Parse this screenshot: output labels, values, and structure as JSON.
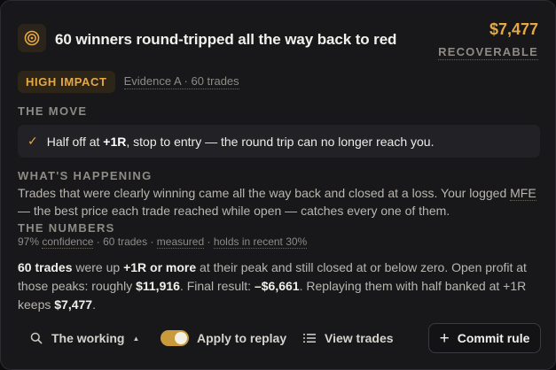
{
  "header": {
    "icon": "target-icon",
    "title": "60 winners round-tripped all the way back to red",
    "amount": "$7,477",
    "amount_label": "RECOVERABLE"
  },
  "tags": {
    "impact": "HIGH IMPACT",
    "evidence": "Evidence A · 60 trades"
  },
  "move": {
    "label": "THE MOVE",
    "prefix": "Half off at ",
    "strong": "+1R",
    "suffix": ", stop to entry — the round trip can no longer reach you."
  },
  "happening": {
    "label": "WHAT'S HAPPENING",
    "text_a": "Trades that were clearly winning came all the way back and closed at a loss. Your logged ",
    "mfe": "MFE",
    "text_b": " — the best price each trade reached while open — catches every one of them."
  },
  "numbers": {
    "label": "THE NUMBERS",
    "conf_pct": "97% ",
    "conf_word": "confidence",
    "sep1": " · 60 trades · ",
    "measured": "measured",
    "sep2": " · ",
    "holds": "holds in recent 30%",
    "p1_b": "60 trades",
    "p1_t": " were up ",
    "p2_b": "+1R or more",
    "p2_t": " at their peak and still closed at or below zero. Open profit at those peaks: roughly ",
    "p3_b": "$11,916",
    "p3_t": ". Final result: ",
    "p4_b": "–$6,661",
    "p4_t": ". Replaying them with half banked at +1R keeps ",
    "p5_b": "$7,477",
    "p5_t": "."
  },
  "footer": {
    "working_label": "The working",
    "replay_label": "Apply to replay",
    "replay_on": true,
    "view_label": "View trades",
    "commit_label": "Commit rule"
  },
  "colors": {
    "accent": "#e6a845",
    "card_bg": "#18181b"
  }
}
